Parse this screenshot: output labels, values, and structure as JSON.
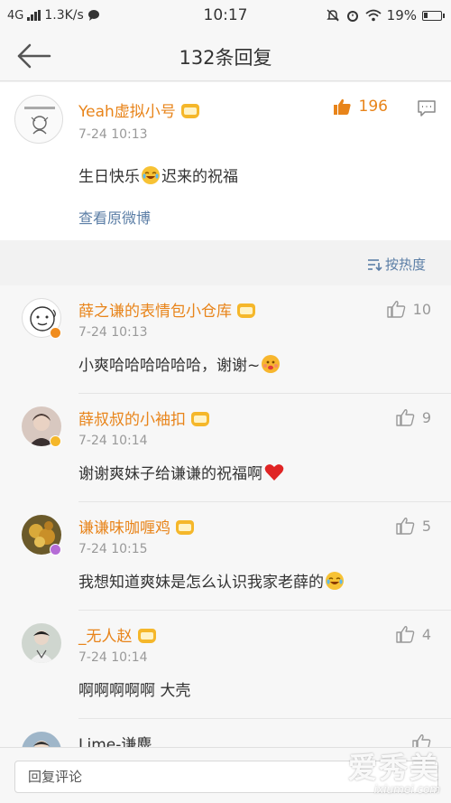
{
  "status_bar": {
    "network": "4G",
    "speed": "1.3K/s",
    "time": "10:17",
    "battery": "19%"
  },
  "header": {
    "title": "132条回复"
  },
  "main_comment": {
    "username": "Yeah虚拟小号",
    "timestamp": "7-24 10:13",
    "text_before": "生日快乐",
    "text_after": "迟来的祝福",
    "view_original": "查看原微博",
    "likes": "196"
  },
  "sort": {
    "label": "按热度"
  },
  "replies": [
    {
      "username": "薛之谦的表情包小仓库",
      "timestamp": "7-24 10:13",
      "text": "小爽哈哈哈哈哈哈，谢谢~",
      "likes": "10",
      "emoji": "blush-face",
      "badge_color": "#f08c1e"
    },
    {
      "username": "薛叔叔的小袖扣",
      "timestamp": "7-24 10:14",
      "text": "谢谢爽妹子给谦谦的祝福啊",
      "likes": "9",
      "emoji": "red-heart",
      "badge_color": "#f5b72a"
    },
    {
      "username": "谦谦味咖喱鸡",
      "timestamp": "7-24 10:15",
      "text": "我想知道爽妹是怎么认识我家老薛的",
      "likes": "5",
      "emoji": "laughing-tears",
      "badge_color": "#b56cd6"
    },
    {
      "username": "_无人赵",
      "timestamp": "7-24 10:14",
      "text": "啊啊啊啊啊 大壳",
      "likes": "4",
      "emoji": "",
      "badge_color": ""
    },
    {
      "username": "Lime-谦麋",
      "timestamp": "",
      "text": "",
      "likes": "",
      "emoji": "",
      "badge_color": ""
    }
  ],
  "input": {
    "placeholder": "回复评论"
  },
  "watermark": {
    "brand": "爱秀美",
    "url": "ixiumei.com"
  },
  "colors": {
    "username": "#e8841a",
    "link": "#5b7ea6",
    "muted": "#999999"
  }
}
